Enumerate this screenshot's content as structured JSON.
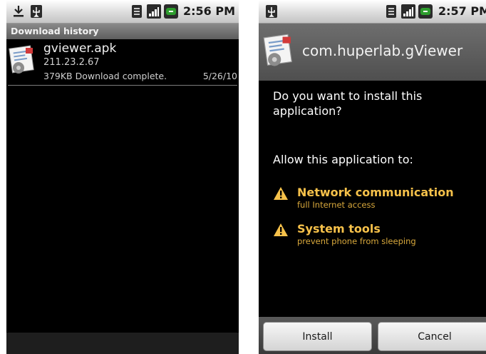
{
  "left": {
    "status": {
      "time": "2:56 PM"
    },
    "title": "Download history",
    "downloads": [
      {
        "name": "gviewer.apk",
        "ip": "211.23.2.67",
        "status": "379KB Download complete.",
        "date": "5/26/10"
      }
    ]
  },
  "right": {
    "status": {
      "time": "2:57 PM"
    },
    "app_name": "com.huperlab.gViewer",
    "question": "Do you want to install this application?",
    "allow": "Allow this application to:",
    "permissions": [
      {
        "title": "Network communication",
        "detail": "full Internet access"
      },
      {
        "title": "System tools",
        "detail": "prevent phone from sleeping"
      }
    ],
    "buttons": {
      "install": "Install",
      "cancel": "Cancel"
    }
  },
  "colors": {
    "perm_title": "#f6c14a",
    "perm_detail": "#d8a83c",
    "battery": "#2e9d2e"
  },
  "icons": [
    "download-icon",
    "usb-icon",
    "vibrate-icon",
    "signal-icon",
    "battery-icon",
    "apk-icon",
    "warning-icon"
  ]
}
